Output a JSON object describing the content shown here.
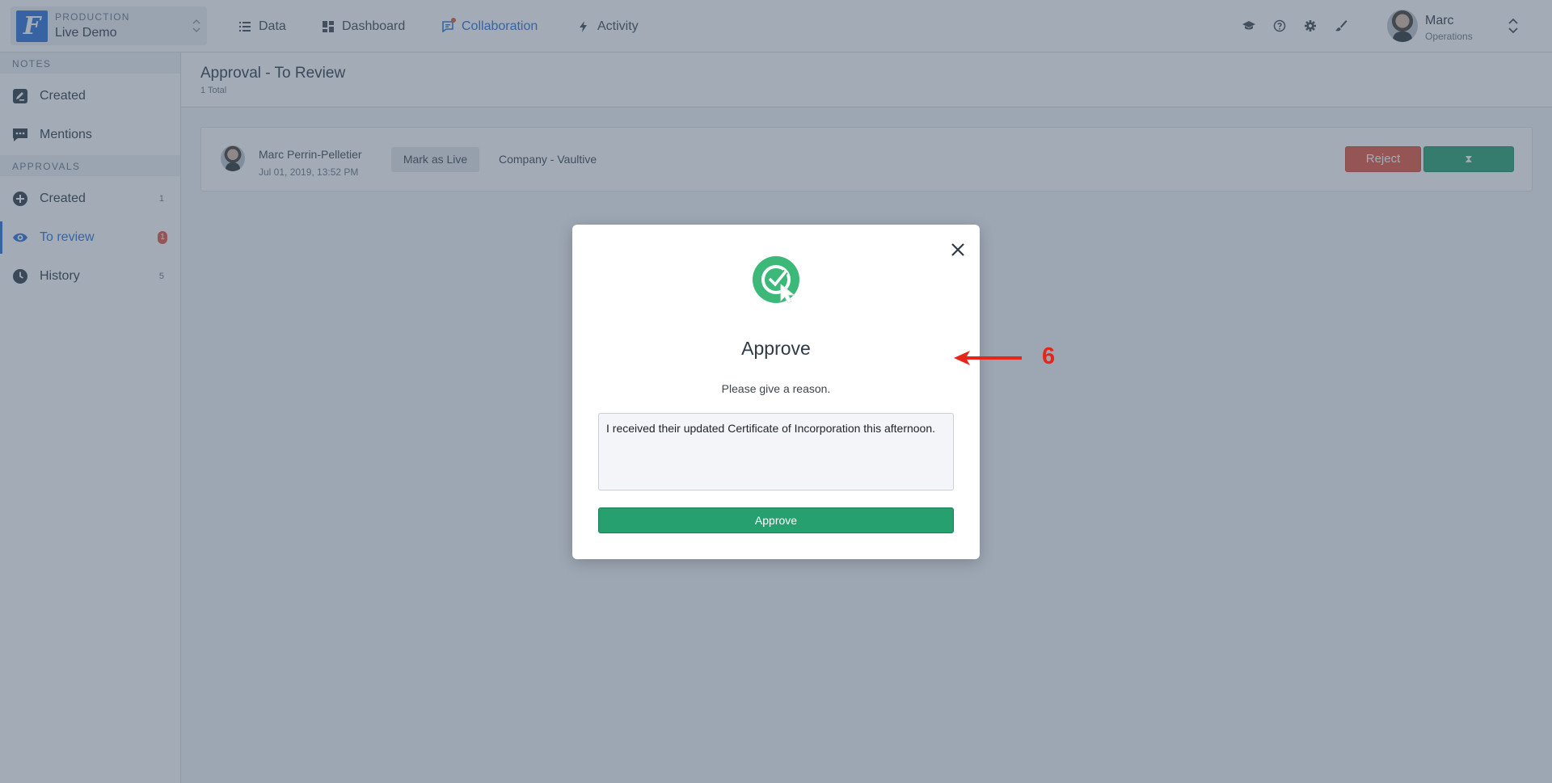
{
  "env": {
    "label": "PRODUCTION",
    "name": "Live Demo",
    "logo_letter": "F",
    "caret_icon": "updown-caret-icon"
  },
  "nav": [
    {
      "label": "Data",
      "icon": "list-icon"
    },
    {
      "label": "Dashboard",
      "icon": "dashboard-icon"
    },
    {
      "label": "Collaboration",
      "icon": "chat-icon",
      "active": true
    },
    {
      "label": "Activity",
      "icon": "bolt-icon"
    }
  ],
  "tools": [
    "graduation-cap-icon",
    "help-icon",
    "gear-icon",
    "brush-icon"
  ],
  "user": {
    "name": "Marc",
    "role": "Operations"
  },
  "sidebar": {
    "notes_label": "NOTES",
    "notes": [
      {
        "label": "Created",
        "icon": "pen-icon"
      },
      {
        "label": "Mentions",
        "icon": "comment-icon"
      }
    ],
    "approvals_label": "APPROVALS",
    "approvals": [
      {
        "label": "Created",
        "icon": "plus-circle-icon",
        "count": "1"
      },
      {
        "label": "To review",
        "icon": "eye-icon",
        "badge": "1",
        "active": true
      },
      {
        "label": "History",
        "icon": "clock-icon",
        "count": "5"
      }
    ]
  },
  "header": {
    "title": "Approval - To Review",
    "subtitle": "1 Total"
  },
  "row": {
    "name": "Marc Perrin-Pelletier",
    "date": "Jul 01, 2019, 13:52 PM",
    "tag": "Mark as Live",
    "company": "Company - Vaultive",
    "reject_label": "Reject",
    "approve_label": "⧗"
  },
  "modal": {
    "title": "Approve",
    "subtitle": "Please give a reason.",
    "reason": "I received their updated Certificate of Incorporation this afternoon.",
    "button_label": "Approve"
  },
  "annotation": {
    "number": "6"
  },
  "colors": {
    "accent": "#2b6fd6",
    "success": "#25a06e",
    "danger": "#e5533c",
    "annotation": "#e8251b"
  }
}
